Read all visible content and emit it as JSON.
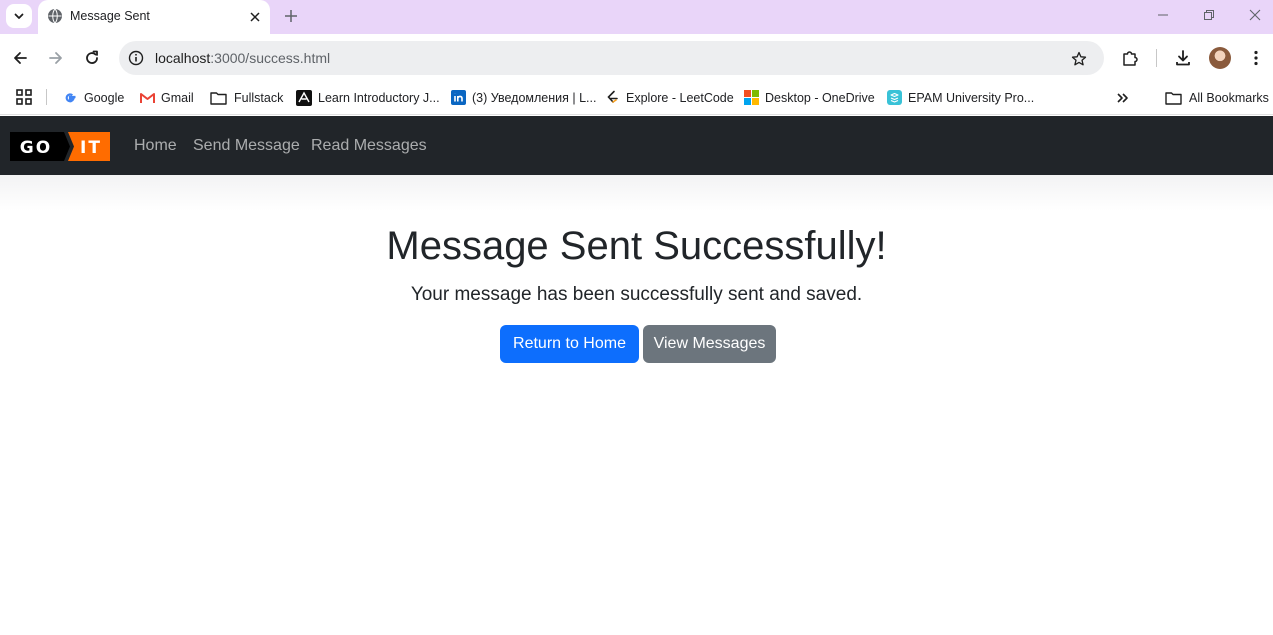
{
  "browser": {
    "tab": {
      "title": "Message Sent"
    },
    "url": {
      "host": "localhost",
      "path": ":3000/success.html"
    },
    "bookmarks": [
      {
        "label": "Google",
        "icon": "google-icon"
      },
      {
        "label": "Gmail",
        "icon": "gmail-icon"
      },
      {
        "label": "Fullstack",
        "icon": "folder-icon"
      },
      {
        "label": "Learn Introductory J...",
        "icon": "learn-site-icon"
      },
      {
        "label": "(3) Уведомления | L...",
        "icon": "linkedin-icon"
      },
      {
        "label": "Explore - LeetCode",
        "icon": "leetcode-icon"
      },
      {
        "label": "Desktop - OneDrive",
        "icon": "microsoft-icon"
      },
      {
        "label": "EPAM University Pro...",
        "icon": "epam-icon"
      }
    ],
    "all_bookmarks_label": "All Bookmarks"
  },
  "site": {
    "logo": {
      "left": "GO",
      "right": "IT",
      "colors": {
        "black": "#000000",
        "orange": "#ff6c00"
      }
    },
    "nav": [
      "Home",
      "Send Message",
      "Read Messages"
    ]
  },
  "main": {
    "heading": "Message Sent Successfully!",
    "lead": "Your message has been successfully sent and saved.",
    "buttons": {
      "home": "Return to Home",
      "view": "View Messages"
    }
  },
  "colors": {
    "tabstrip": "#e9d5f9",
    "navbar": "#212529",
    "primary": "#0d6efd",
    "secondary": "#6c757d"
  }
}
